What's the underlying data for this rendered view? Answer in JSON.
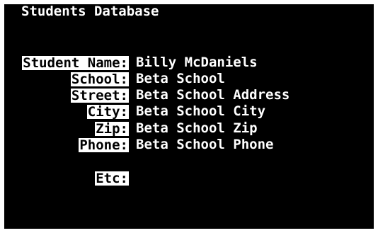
{
  "app": {
    "title": "Students Database"
  },
  "record": {
    "fields": [
      {
        "label": "Student Name",
        "value": "Billy McDaniels"
      },
      {
        "label": "School",
        "value": "Beta School"
      },
      {
        "label": "Street",
        "value": "Beta School Address"
      },
      {
        "label": "City",
        "value": "Beta School City"
      },
      {
        "label": "Zip",
        "value": "Beta School Zip"
      },
      {
        "label": "Phone",
        "value": "Beta School Phone"
      },
      {
        "label": "Etc",
        "value": ""
      }
    ],
    "separator": ":"
  }
}
